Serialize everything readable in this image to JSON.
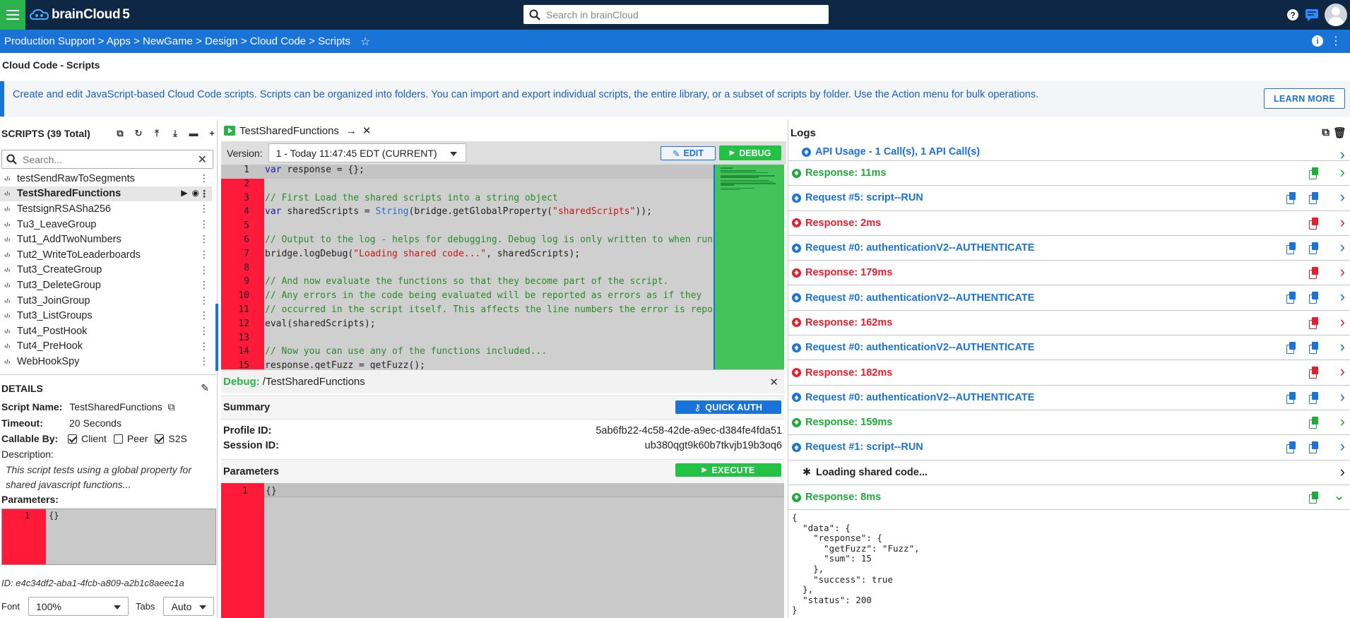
{
  "app": {
    "logo_text": "brainCloud",
    "logo_version": "5",
    "search_placeholder": "Search in brainCloud"
  },
  "breadcrumb": [
    "Production Support",
    "Apps",
    "NewGame",
    "Design",
    "Cloud Code",
    "Scripts"
  ],
  "page_title": "Cloud Code - Scripts",
  "banner": {
    "text": "Create and edit JavaScript-based Cloud Code scripts. Scripts can be organized into folders. You can import and export individual scripts, the entire library, or a subset of scripts by folder. Use the Action menu for bulk operations.",
    "learn_more": "LEARN MORE"
  },
  "scripts": {
    "header": "SCRIPTS (39 Total)",
    "search_placeholder": "Search...",
    "items": [
      "testSendRawToSegments",
      "TestSharedFunctions",
      "TestsignRSASha256",
      "Tu3_LeaveGroup",
      "Tut1_AddTwoNumbers",
      "Tut2_WriteToLeaderboards",
      "Tut3_CreateGroup",
      "Tut3_DeleteGroup",
      "Tut3_JoinGroup",
      "Tut3_ListGroups",
      "Tut4_PostHook",
      "Tut4_PreHook",
      "WebHookSpy"
    ],
    "selected_index": 1
  },
  "details": {
    "header": "DETAILS",
    "script_name_label": "Script Name:",
    "script_name": "TestSharedFunctions",
    "timeout_label": "Timeout:",
    "timeout": "20 Seconds",
    "callable_label": "Callable By:",
    "callable": [
      {
        "label": "Client",
        "checked": true
      },
      {
        "label": "Peer",
        "checked": false
      },
      {
        "label": "S2S",
        "checked": true
      }
    ],
    "description_label": "Description:",
    "description": "This script tests using a global property for shared javascript functions...",
    "parameters_label": "Parameters:",
    "param_line_no": "1",
    "param_value": "{}",
    "id_label": "ID:",
    "id": "e4c34df2-aba1-4fcb-a809-a2b1c8aeec1a",
    "font_label": "Font",
    "font_value": "100%",
    "tabs_label": "Tabs",
    "tabs_value": "Auto"
  },
  "editor": {
    "tab_name": "TestSharedFunctions",
    "version_label": "Version:",
    "version_value": "1 - Today 11:47:45 EDT (CURRENT)",
    "edit_label": "EDIT",
    "debug_label": "DEBUG",
    "lines": [
      {
        "n": "1",
        "text": "var response = {};"
      },
      {
        "n": "2",
        "text": ""
      },
      {
        "n": "3",
        "text": "// First Load the shared scripts into a string object"
      },
      {
        "n": "4",
        "text": "var sharedScripts = String(bridge.getGlobalProperty(\"sharedScripts\"));"
      },
      {
        "n": "5",
        "text": ""
      },
      {
        "n": "6",
        "text": "// Output to the log - helps for debugging. Debug log is only written to when run"
      },
      {
        "n": "7",
        "text": "bridge.logDebug(\"Loading shared code...\", sharedScripts);"
      },
      {
        "n": "8",
        "text": ""
      },
      {
        "n": "9",
        "text": "// And now evaluate the functions so that they become part of the script."
      },
      {
        "n": "10",
        "text": "// Any errors in the code being evaluated will be reported as errors as if they"
      },
      {
        "n": "11",
        "text": "// occurred in the script itself. This affects the line numbers the error is repor"
      },
      {
        "n": "12",
        "text": "eval(sharedScripts);"
      },
      {
        "n": "13",
        "text": ""
      },
      {
        "n": "14",
        "text": "// Now you can use any of the functions included..."
      },
      {
        "n": "15",
        "text": "response.getFuzz = getFuzz();"
      }
    ]
  },
  "debug": {
    "label": "Debug:",
    "path": "/TestSharedFunctions",
    "summary_label": "Summary",
    "quick_auth": "QUICK AUTH",
    "profile_label": "Profile ID:",
    "profile_id": "5ab6fb22-4c58-42de-a9ec-d384fe4fda51",
    "session_label": "Session ID:",
    "session_id": "ub380qgt9k60b7tkvjb19b3oq6",
    "parameters_label": "Parameters",
    "execute": "EXECUTE",
    "param_line_no": "1",
    "param_value": "{}"
  },
  "logs": {
    "header": "Logs",
    "entries": [
      {
        "type": "blue",
        "dir": "up",
        "text": "API Usage - 1 Call(s), 1 API Call(s)",
        "copies": 0,
        "top": true
      },
      {
        "type": "green",
        "dir": "down",
        "text": "Response: 11ms",
        "copies": 1
      },
      {
        "type": "blue",
        "dir": "up",
        "text": "Request #5: script--RUN",
        "copies": 2
      },
      {
        "type": "red",
        "dir": "down",
        "text": "Response: 2ms",
        "copies": 1
      },
      {
        "type": "blue",
        "dir": "up",
        "text": "Request #0: authenticationV2--AUTHENTICATE",
        "copies": 2
      },
      {
        "type": "red",
        "dir": "down",
        "text": "Response: 179ms",
        "copies": 1
      },
      {
        "type": "blue",
        "dir": "up",
        "text": "Request #0: authenticationV2--AUTHENTICATE",
        "copies": 2
      },
      {
        "type": "red",
        "dir": "down",
        "text": "Response: 162ms",
        "copies": 1
      },
      {
        "type": "blue",
        "dir": "up",
        "text": "Request #0: authenticationV2--AUTHENTICATE",
        "copies": 2
      },
      {
        "type": "red",
        "dir": "down",
        "text": "Response: 182ms",
        "copies": 1
      },
      {
        "type": "blue",
        "dir": "up",
        "text": "Request #0: authenticationV2--AUTHENTICATE",
        "copies": 2
      },
      {
        "type": "green",
        "dir": "down",
        "text": "Response: 159ms",
        "copies": 1
      },
      {
        "type": "blue",
        "dir": "up",
        "text": "Request #1: script--RUN",
        "copies": 2
      },
      {
        "type": "dark",
        "dir": "bug",
        "text": "Loading shared code...",
        "copies": 0
      },
      {
        "type": "green",
        "dir": "down",
        "text": "Response: 8ms",
        "copies": 1,
        "expanded": true
      }
    ],
    "json_output": "{\n  \"data\": {\n    \"response\": {\n      \"getFuzz\": \"Fuzz\",\n      \"sum\": 15\n    },\n    \"success\": true\n  },\n  \"status\": 200\n}"
  },
  "colors": {
    "topbar": "#0d2744",
    "accent": "#1a73d6",
    "success": "#1faa3c",
    "error": "#e4202f"
  }
}
